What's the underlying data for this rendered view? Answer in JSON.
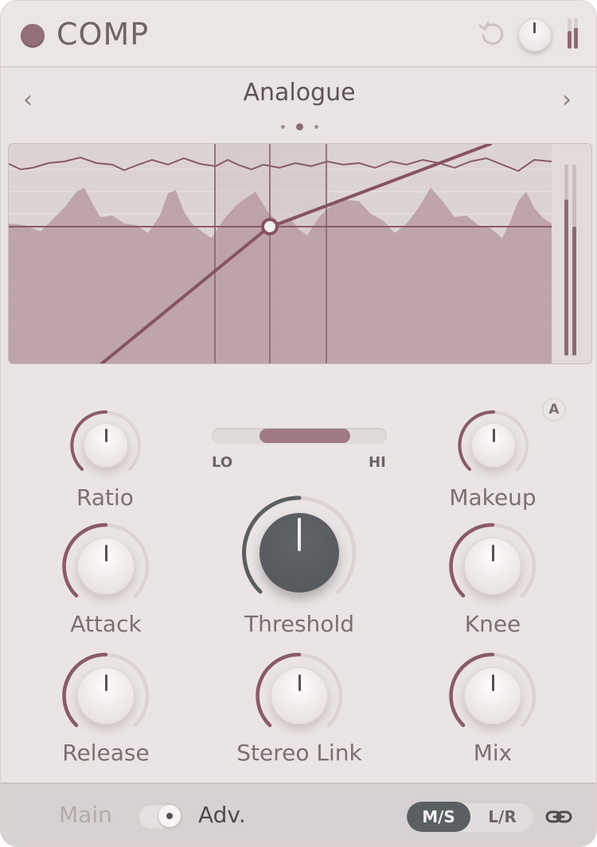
{
  "header": {
    "title": "COMP",
    "accent": "#94717a"
  },
  "preset": {
    "name": "Analogue",
    "prev_glyph": "‹",
    "next_glyph": "›",
    "page_count": 3,
    "active_page": 2
  },
  "knobs": {
    "ratio": {
      "label": "Ratio",
      "value": 0.5
    },
    "makeup": {
      "label": "Makeup",
      "value": 0.5
    },
    "attack": {
      "label": "Attack",
      "value": 0.5
    },
    "threshold": {
      "label": "Threshold",
      "value": 0.5
    },
    "knee": {
      "label": "Knee",
      "value": 0.5
    },
    "release": {
      "label": "Release",
      "value": 0.5
    },
    "stereo_link": {
      "label": "Stereo Link",
      "value": 0.5
    },
    "mix": {
      "label": "Mix",
      "value": 0.5
    }
  },
  "sidechain_filter": {
    "lo_label": "LO",
    "hi_label": "HI"
  },
  "makeup_auto_label": "A",
  "footer": {
    "main_label": "Main",
    "adv_label": "Adv.",
    "ms_label": "M/S",
    "lr_label": "L/R"
  },
  "colors": {
    "panel": "#eae5e4",
    "accent": "#94717a",
    "knob_dark": "#555a5d"
  }
}
